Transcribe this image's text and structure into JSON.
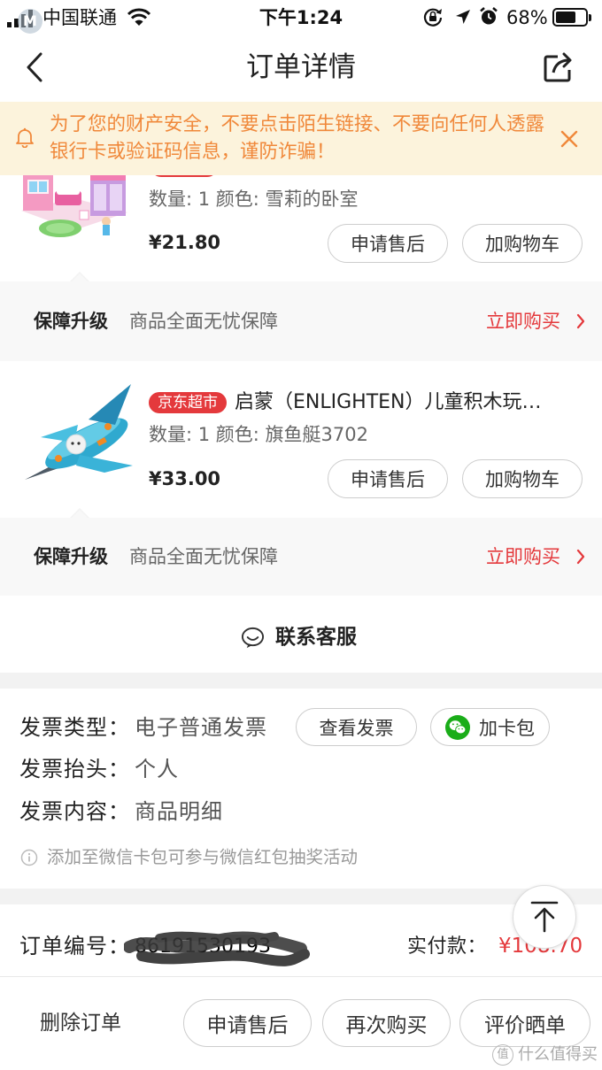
{
  "status_bar": {
    "carrier": "中国联通",
    "time": "下午1:24",
    "battery_text": "68%",
    "battery_level": 0.68
  },
  "nav": {
    "title": "订单详情"
  },
  "banner": {
    "lines": [
      "为了您的财产安全，不要点击陌生链接、不要向任何人透露",
      "银行卡或验证码信息，谨防诈骗！"
    ]
  },
  "products": [
    {
      "spec": "数量: 1 颜色: 雪莉的卧室",
      "price": "¥21.80",
      "buttons": [
        "申请售后",
        "加购物车"
      ],
      "protection": {
        "label": "保障升级",
        "desc": "商品全面无忧保障",
        "action": "立即购买"
      }
    },
    {
      "badge": "京东超市",
      "title": "启蒙（ENLIGHTEN）儿童积木玩…",
      "spec": "数量: 1 颜色: 旗鱼艇3702",
      "price": "¥33.00",
      "buttons": [
        "申请售后",
        "加购物车"
      ],
      "protection": {
        "label": "保障升级",
        "desc": "商品全面无忧保障",
        "action": "立即购买"
      }
    }
  ],
  "contact": {
    "label": "联系客服"
  },
  "invoice": {
    "rows": [
      {
        "label": "发票类型：",
        "value": "电子普通发票"
      },
      {
        "label": "发票抬头：",
        "value": "个人"
      },
      {
        "label": "发票内容：",
        "value": "商品明细"
      }
    ],
    "view_button": "查看发票",
    "card_button": "加卡包",
    "note": "添加至微信卡包可参与微信红包抽奖活动"
  },
  "order": {
    "number_label": "订单编号：",
    "number": "86191530193",
    "paid_label": "实付款：",
    "paid": "¥108.70"
  },
  "bottom_bar": {
    "delete": "删除订单",
    "buttons": [
      "申请售后",
      "再次购买",
      "评价晒单"
    ]
  },
  "watermark": {
    "top_logo": "M",
    "logo": "值",
    "text": "什么值得买"
  },
  "icons": {
    "status": [
      "signal-icon",
      "wifi-icon",
      "rotation-lock-icon",
      "location-icon",
      "alarm-icon",
      "battery-icon"
    ],
    "nav": [
      "back-chevron-icon",
      "share-icon"
    ],
    "banner": [
      "bell-icon",
      "close-icon"
    ],
    "contact": "customer-service-icon",
    "wechat": "wechat-icon",
    "info": "info-icon",
    "scroll_top": "scroll-to-top-icon"
  },
  "colors": {
    "accent_red": "#e4393c",
    "banner_bg": "#fcf3dc",
    "banner_text": "#f0883a",
    "wechat_green": "#1aad19"
  }
}
